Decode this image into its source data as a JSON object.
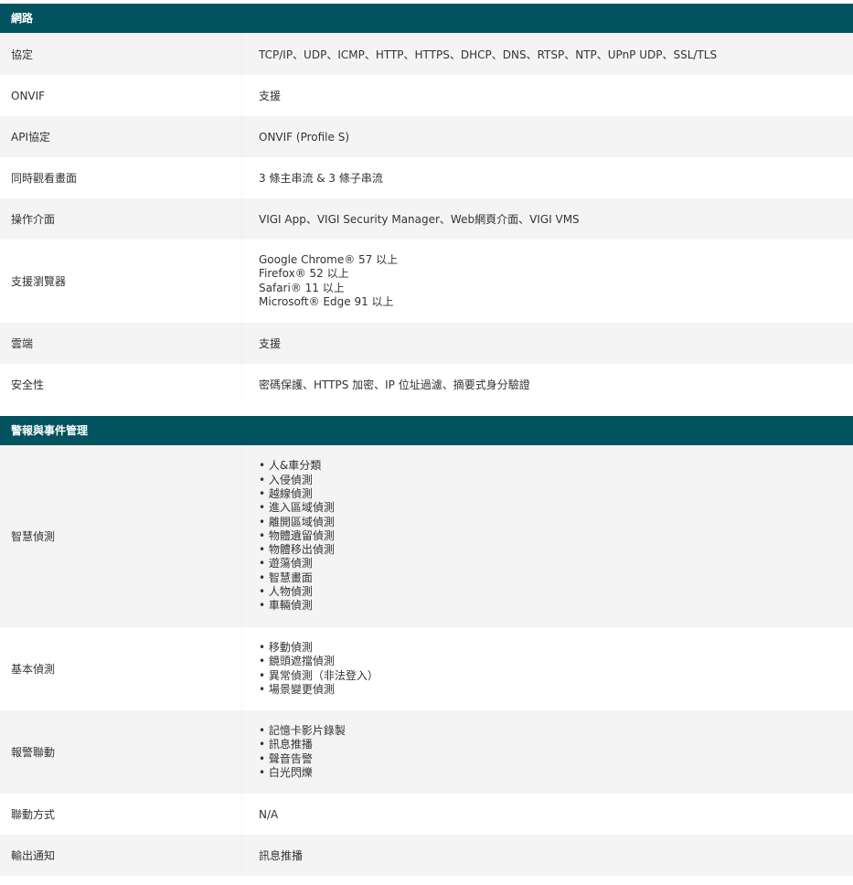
{
  "sections": [
    {
      "title": "網路",
      "rows": [
        {
          "label": "協定",
          "value": "TCP/IP、UDP、ICMP、HTTP、HTTPS、DHCP、DNS、RTSP、NTP、UPnP UDP、SSL/TLS"
        },
        {
          "label": "ONVIF",
          "value": "支援"
        },
        {
          "label": "API協定",
          "value": "ONVIF (Profile S)"
        },
        {
          "label": "同時觀看畫面",
          "value": "3 條主串流 & 3 條子串流"
        },
        {
          "label": "操作介面",
          "value": "VIGI App、VIGI Security Manager、Web網頁介面、VIGI VMS"
        },
        {
          "label": "支援瀏覽器",
          "lines": [
            "Google Chrome® 57 以上",
            "Firefox® 52 以上",
            "Safari® 11 以上",
            "Microsoft® Edge 91 以上"
          ]
        },
        {
          "label": "雲端",
          "value": "支援"
        },
        {
          "label": "安全性",
          "value": "密碼保護、HTTPS 加密、IP 位址過濾、摘要式身分驗證"
        }
      ]
    },
    {
      "title": "警報與事件管理",
      "rows": [
        {
          "label": "智慧偵測",
          "bullets": [
            "人&車分類",
            "入侵偵測",
            "越線偵測",
            "進入區域偵測",
            "離開區域偵測",
            "物體遺留偵測",
            "物體移出偵測",
            "遊蕩偵測",
            "智慧畫面",
            "人物偵測",
            "車輛偵測"
          ]
        },
        {
          "label": "基本偵測",
          "bullets": [
            "移動偵測",
            "鏡頭遮擋偵測",
            "異常偵測（非法登入）",
            "場景變更偵測"
          ]
        },
        {
          "label": "報警聯動",
          "bullets": [
            "記憶卡影片錄製",
            "訊息推播",
            "聲音告警",
            "白光閃爍"
          ]
        },
        {
          "label": "聯動方式",
          "value": "N/A"
        },
        {
          "label": "輸出通知",
          "value": "訊息推播"
        }
      ]
    }
  ]
}
